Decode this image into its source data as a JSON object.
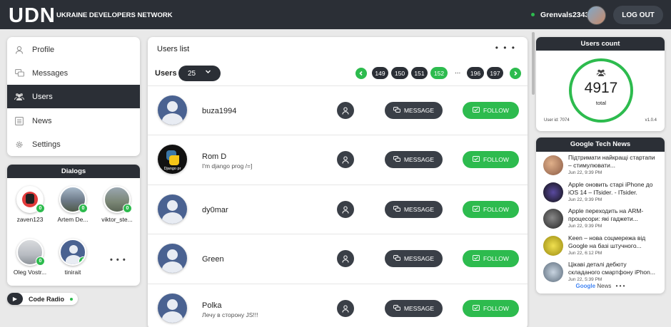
{
  "header": {
    "logo": "UDN",
    "subtitle": "UKRAINE DEVELOPERS NETWORK",
    "username": "Grenvals2343",
    "logout_label": "LOG OUT"
  },
  "menu": {
    "items": [
      {
        "label": "Profile",
        "icon": "person-icon"
      },
      {
        "label": "Messages",
        "icon": "chat-icon"
      },
      {
        "label": "Users",
        "icon": "users-icon"
      },
      {
        "label": "News",
        "icon": "news-icon"
      },
      {
        "label": "Settings",
        "icon": "gear-icon"
      }
    ],
    "active": "Users"
  },
  "dialogs": {
    "title": "Dialogs",
    "items": [
      {
        "name": "zaven123",
        "unread": "0",
        "color": "#e23b3b"
      },
      {
        "name": "Artem De...",
        "unread": "0",
        "color": "#7d8aa0"
      },
      {
        "name": "viktor_ste...",
        "unread": "0",
        "color": "#7a8675"
      },
      {
        "name": "Oleg Vostr...",
        "unread": "0",
        "color": "#b8bcc2"
      },
      {
        "name": "tinirait",
        "unread": "0",
        "color": "#4a6291"
      }
    ],
    "more": "• • •"
  },
  "radio": {
    "label": "Code Radio"
  },
  "users_list": {
    "title": "Users list",
    "menu_dots": "• • •",
    "users_label": "Users",
    "per_page": "25",
    "pages": [
      "149",
      "150",
      "151",
      "152",
      "196",
      "197"
    ],
    "current_page": "152",
    "ellipsis": "...",
    "message_label": "MESSAGE",
    "follow_label": "FOLLOW",
    "users": [
      {
        "name": "buza1994",
        "status": ""
      },
      {
        "name": "Rom D",
        "status": "I'm django prog /=]"
      },
      {
        "name": "dy0mar",
        "status": ""
      },
      {
        "name": "Green",
        "status": ""
      },
      {
        "name": "Polka",
        "status": "Лечу в сторону JS!!!"
      }
    ],
    "django_avatar_text": "Django pr"
  },
  "users_count": {
    "title": "Users count",
    "count": "4917",
    "count_label": "total",
    "user_id": "User id: 7074",
    "version": "v1.0.4"
  },
  "google_news": {
    "title": "Google Tech News",
    "items": [
      {
        "title": "Підтримати найкращі стартапи – стимулювати...",
        "date": "Jun 22, 9:39 PM",
        "color": "#a0705a"
      },
      {
        "title": "Apple оновить старі iPhone до iOS 14 – ITsider. - ITsider.",
        "date": "Jun 22, 9:39 PM",
        "color": "#1e1e2a"
      },
      {
        "title": "Apple переходить на ARM-процесори: які гаджети...",
        "date": "Jun 22, 9:39 PM",
        "color": "#3a3a3a"
      },
      {
        "title": "Keen – нова соцмережа від Google на базі штучного...",
        "date": "Jun 22, 6:12 PM",
        "color": "#d8c830"
      },
      {
        "title": "Цікаві деталі дебюту складаного смартфону iPhon...",
        "date": "Jun 22, 5:39 PM",
        "color": "#8a9aaa"
      }
    ],
    "footer_brand": "Google",
    "footer_label": "News",
    "footer_dots": "• • •"
  },
  "colors": {
    "accent": "#2dbb4e",
    "dark": "#2b2f36",
    "avatar_default": "#4a6291"
  }
}
